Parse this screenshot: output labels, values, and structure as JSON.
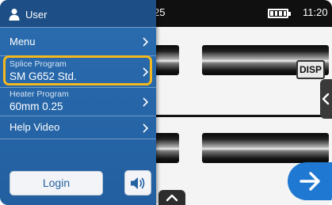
{
  "status": {
    "left_text": "25",
    "time": "11:20"
  },
  "camera": {
    "disp_label": "DISP"
  },
  "drawer": {
    "user_label": "User",
    "menu_label": "Menu",
    "splice_program": {
      "title": "Splice Program",
      "value": "SM G652 Std."
    },
    "heater_program": {
      "title": "Heater Program",
      "value": "60mm 0.25"
    },
    "help_video_label": "Help Video",
    "login_label": "Login"
  },
  "colors": {
    "drawer": "#2b6db0",
    "highlight": "#f5b81c",
    "accent_button": "#1f78d1"
  },
  "icons": [
    "user-icon",
    "chevron-right-icon",
    "speaker-icon",
    "arrow-right-icon",
    "chevron-up-icon",
    "chevron-left-icon",
    "battery-icon"
  ]
}
